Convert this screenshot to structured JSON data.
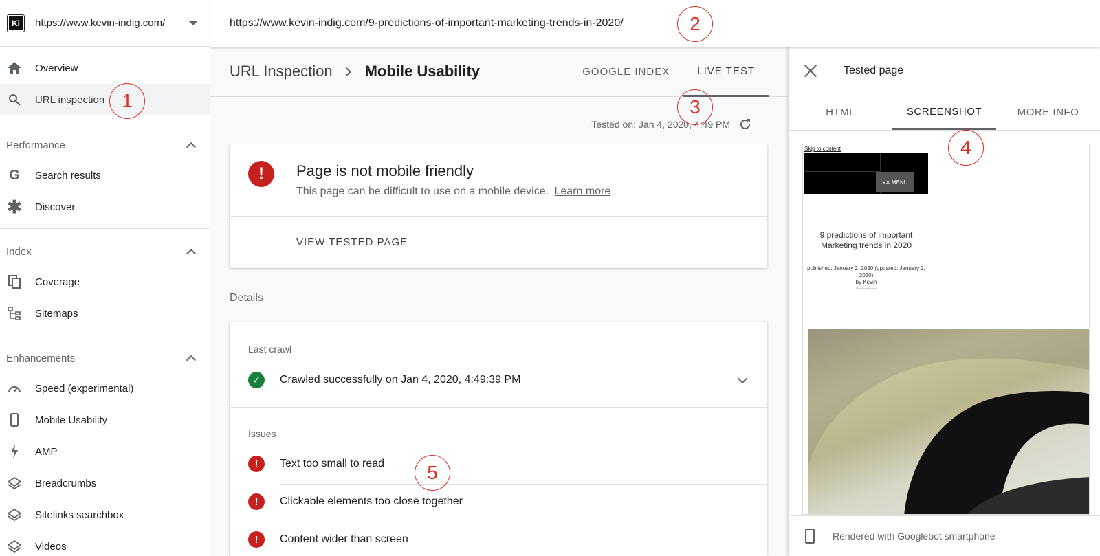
{
  "property": {
    "logo_text": "Ki",
    "url": "https://www.kevin-indig.com/"
  },
  "sidebar": {
    "overview": "Overview",
    "url_inspection": "URL inspection",
    "groups": [
      {
        "title": "Performance",
        "items": [
          "Search results",
          "Discover"
        ]
      },
      {
        "title": "Index",
        "items": [
          "Coverage",
          "Sitemaps"
        ]
      },
      {
        "title": "Enhancements",
        "items": [
          "Speed (experimental)",
          "Mobile Usability",
          "AMP",
          "Breadcrumbs",
          "Sitelinks searchbox",
          "Videos"
        ]
      }
    ]
  },
  "topbar": {
    "inspected_url": "https://www.kevin-indig.com/9-predictions-of-important-marketing-trends-in-2020/"
  },
  "main": {
    "breadcrumb_root": "URL Inspection",
    "breadcrumb_current": "Mobile Usability",
    "tabs": [
      "GOOGLE INDEX",
      "LIVE TEST"
    ],
    "tested_on": "Tested on: Jan 4, 2020, 4:49 PM",
    "status_title": "Page is not mobile friendly",
    "status_sub": "This page can be difficult to use on a mobile device.",
    "learn_more": "Learn more",
    "view_tested_page": "VIEW TESTED PAGE",
    "details_label": "Details",
    "last_crawl_label": "Last crawl",
    "crawl_text": "Crawled successfully on Jan 4, 2020, 4:49:39 PM",
    "issues_label": "Issues",
    "issues": [
      "Text too small to read",
      "Clickable elements too close together",
      "Content wider than screen"
    ]
  },
  "panel": {
    "title": "Tested page",
    "tabs": [
      "HTML",
      "SCREENSHOT",
      "MORE INFO"
    ],
    "screenshot": {
      "skip": "Skip to content",
      "menu": "≡✕ MENU",
      "post_title": "9 predictions of important Marketing trends in 2020",
      "post_meta": "published: January 2, 2020 (updated: January 2, 2020)",
      "by": "by",
      "author": "Kevin",
      "read_time": "19 min well spent"
    },
    "footer": "Rendered with Googlebot smartphone"
  },
  "annotations": [
    "1",
    "2",
    "3",
    "4",
    "5"
  ],
  "colors": {
    "error": "#c5221f",
    "success": "#188038",
    "annotation": "#d93025"
  }
}
